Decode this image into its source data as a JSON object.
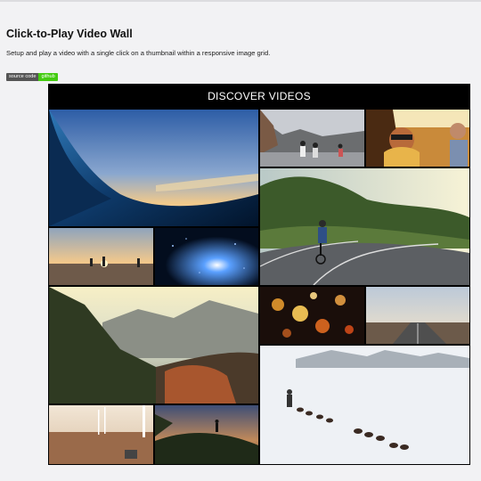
{
  "page": {
    "title": "Click-to-Play Video Wall",
    "description": "Setup and play a video with a single click on a thumbnail within a responsive image grid.",
    "badge": {
      "left": "source code",
      "right": "github"
    }
  },
  "wall": {
    "heading": "DISCOVER VIDEOS",
    "thumbnails": [
      "ocean wave thumbnail",
      "cyclists on mountain road thumbnail",
      "friends in car thumbnail",
      "cyclist on coastal road thumbnail",
      "people at sunset beach thumbnail",
      "fireworks sparks thumbnail",
      "mountain valley sunset thumbnail",
      "bokeh lights thumbnail",
      "desert highway dusk thumbnail",
      "dog sled in snow thumbnail",
      "wind turbines field thumbnail",
      "hiker on hill thumbnail"
    ]
  }
}
